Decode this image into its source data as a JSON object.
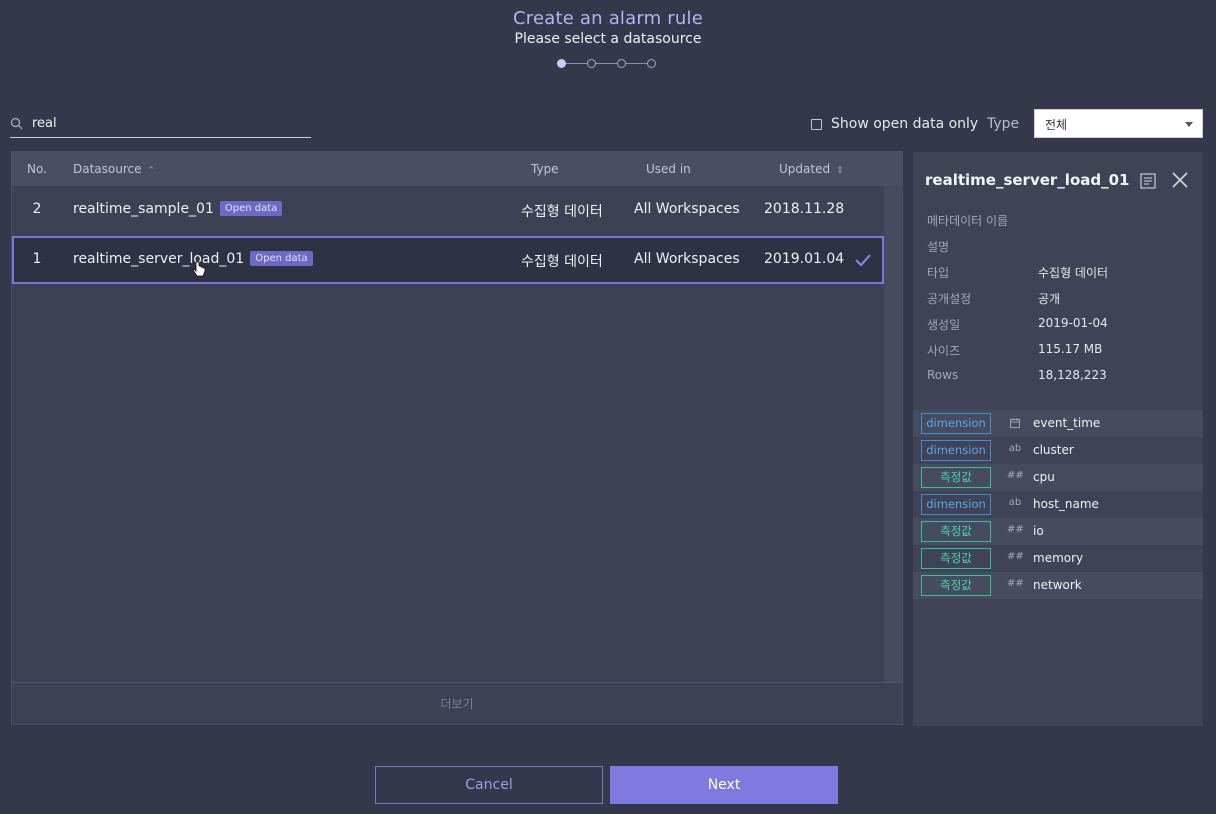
{
  "header": {
    "title": "Create an alarm rule",
    "subtitle": "Please select a datasource",
    "steps_total": 4,
    "current_step": 1
  },
  "search": {
    "value": "real",
    "placeholder": ""
  },
  "filter": {
    "open_only_label": "Show open data only",
    "open_only_checked": false,
    "type_label": "Type",
    "type_value": "전체"
  },
  "table": {
    "headers": {
      "no": "No.",
      "datasource": "Datasource",
      "type": "Type",
      "used_in": "Used in",
      "updated": "Updated"
    },
    "rows": [
      {
        "no": "2",
        "name": "realtime_sample_01",
        "badge": "Open data",
        "type": "수집형 데이터",
        "used_in": "All Workspaces",
        "updated": "2018.11.28",
        "selected": false
      },
      {
        "no": "1",
        "name": "realtime_server_load_01",
        "badge": "Open data",
        "type": "수집형 데이터",
        "used_in": "All Workspaces",
        "updated": "2019.01.04",
        "selected": true
      }
    ],
    "more_label": "더보기"
  },
  "detail": {
    "title": "realtime_server_load_01",
    "meta": [
      {
        "label": "메타데이터 이름",
        "value": ""
      },
      {
        "label": "설명",
        "value": ""
      },
      {
        "label": "타입",
        "value": "수집형 데이터"
      },
      {
        "label": "공개설정",
        "value": "공개"
      },
      {
        "label": "생성일",
        "value": "2019-01-04"
      },
      {
        "label": "사이즈",
        "value": "115.17 MB"
      },
      {
        "label": "Rows",
        "value": "18,128,223"
      }
    ],
    "columns": [
      {
        "role": "dimension",
        "type_icon": "calendar-icon",
        "type": "",
        "name": "event_time"
      },
      {
        "role": "dimension",
        "type_icon": "string-icon",
        "type": "ab",
        "name": "cluster"
      },
      {
        "role": "측정값",
        "type_icon": "number-icon",
        "type": "##",
        "name": "cpu"
      },
      {
        "role": "dimension",
        "type_icon": "string-icon",
        "type": "ab",
        "name": "host_name"
      },
      {
        "role": "측정값",
        "type_icon": "number-icon",
        "type": "##",
        "name": "io"
      },
      {
        "role": "측정값",
        "type_icon": "number-icon",
        "type": "##",
        "name": "memory"
      },
      {
        "role": "측정값",
        "type_icon": "number-icon",
        "type": "##",
        "name": "network"
      }
    ]
  },
  "buttons": {
    "cancel": "Cancel",
    "next": "Next"
  },
  "colors": {
    "accent": "#7f79e0",
    "dimension": "#3f8ed8",
    "measure": "#2fc39a"
  }
}
